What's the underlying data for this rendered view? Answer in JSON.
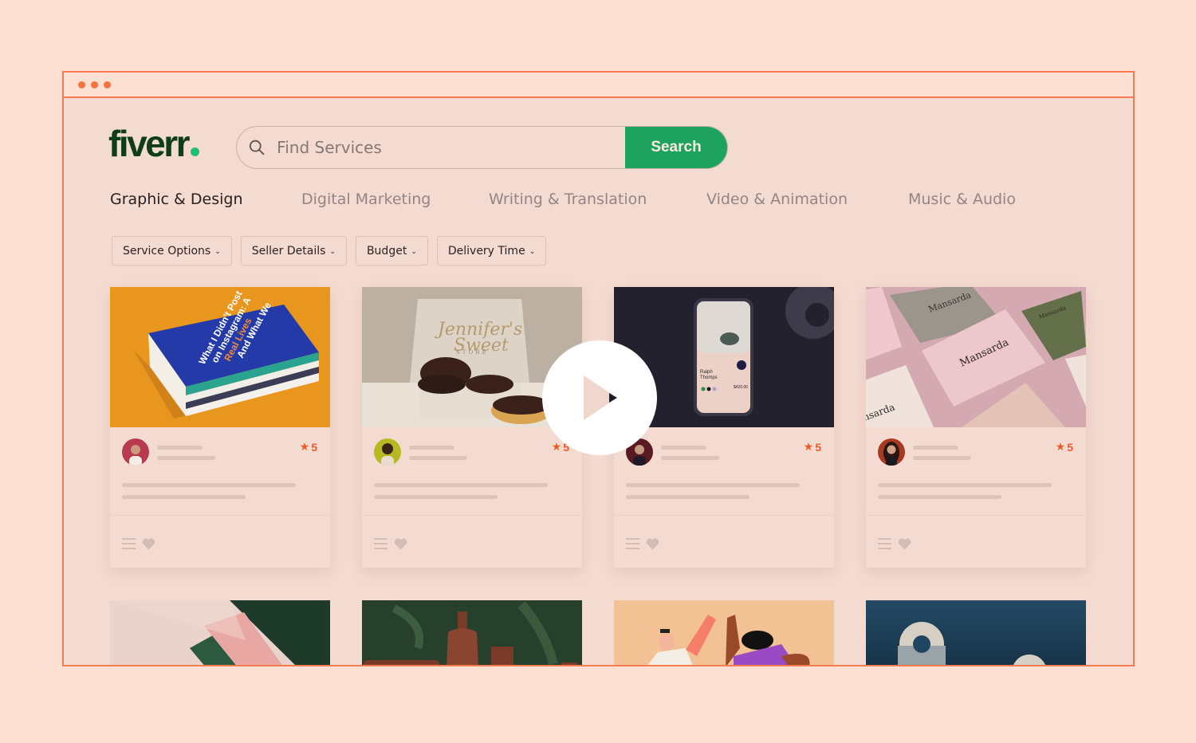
{
  "window": {
    "controls": [
      "dot-1",
      "dot-2",
      "dot-3"
    ]
  },
  "header": {
    "logo_text": "fiverr",
    "search": {
      "placeholder": "Find Services",
      "value": "",
      "button_label": "Search"
    }
  },
  "categories": [
    {
      "label": "Graphic & Design",
      "active": true
    },
    {
      "label": "Digital Marketing",
      "active": false
    },
    {
      "label": "Writing & Translation",
      "active": false
    },
    {
      "label": "Video & Animation",
      "active": false
    },
    {
      "label": "Music & Audio",
      "active": false
    }
  ],
  "filters": [
    {
      "label": "Service Options",
      "icon": "chevron-down-icon"
    },
    {
      "label": "Seller Details",
      "icon": "chevron-down-icon"
    },
    {
      "label": "Budget",
      "icon": "chevron-down-icon"
    },
    {
      "label": "Delivery Time",
      "icon": "chevron-down-icon"
    }
  ],
  "gigs": [
    {
      "image": "book-cover-design",
      "image_text": "What I Didn't Post on Instagram: A Collection of Essays on Real Lives And What We Filter Out",
      "rating": "5",
      "avatar_color": "#b83a4e"
    },
    {
      "image": "donut-box-packaging",
      "image_text": "Jennifer's Sweet STORE",
      "rating": "5",
      "avatar_color": "#b8b820"
    },
    {
      "image": "mobile-app-mockup",
      "image_text": "Ralph Thomps $420.00",
      "rating": "5",
      "avatar_color": "#5a1a24"
    },
    {
      "image": "business-card-branding",
      "image_text": "Mansarda",
      "rating": "5",
      "avatar_color": "#a83a22"
    }
  ],
  "gigs_row2": [
    {
      "image": "business-cards-green-pink"
    },
    {
      "image": "cosmetic-bottles-packaging"
    },
    {
      "image": "high-five-illustration"
    },
    {
      "image": "3d-shapes-render"
    }
  ],
  "video": {
    "icon": "play-icon"
  },
  "colors": {
    "accent": "#f47c50",
    "brand_green": "#1ea35f",
    "logo_green": "#0f3d1a",
    "rating": "#f05a28",
    "page_bg": "#fde0d4"
  }
}
